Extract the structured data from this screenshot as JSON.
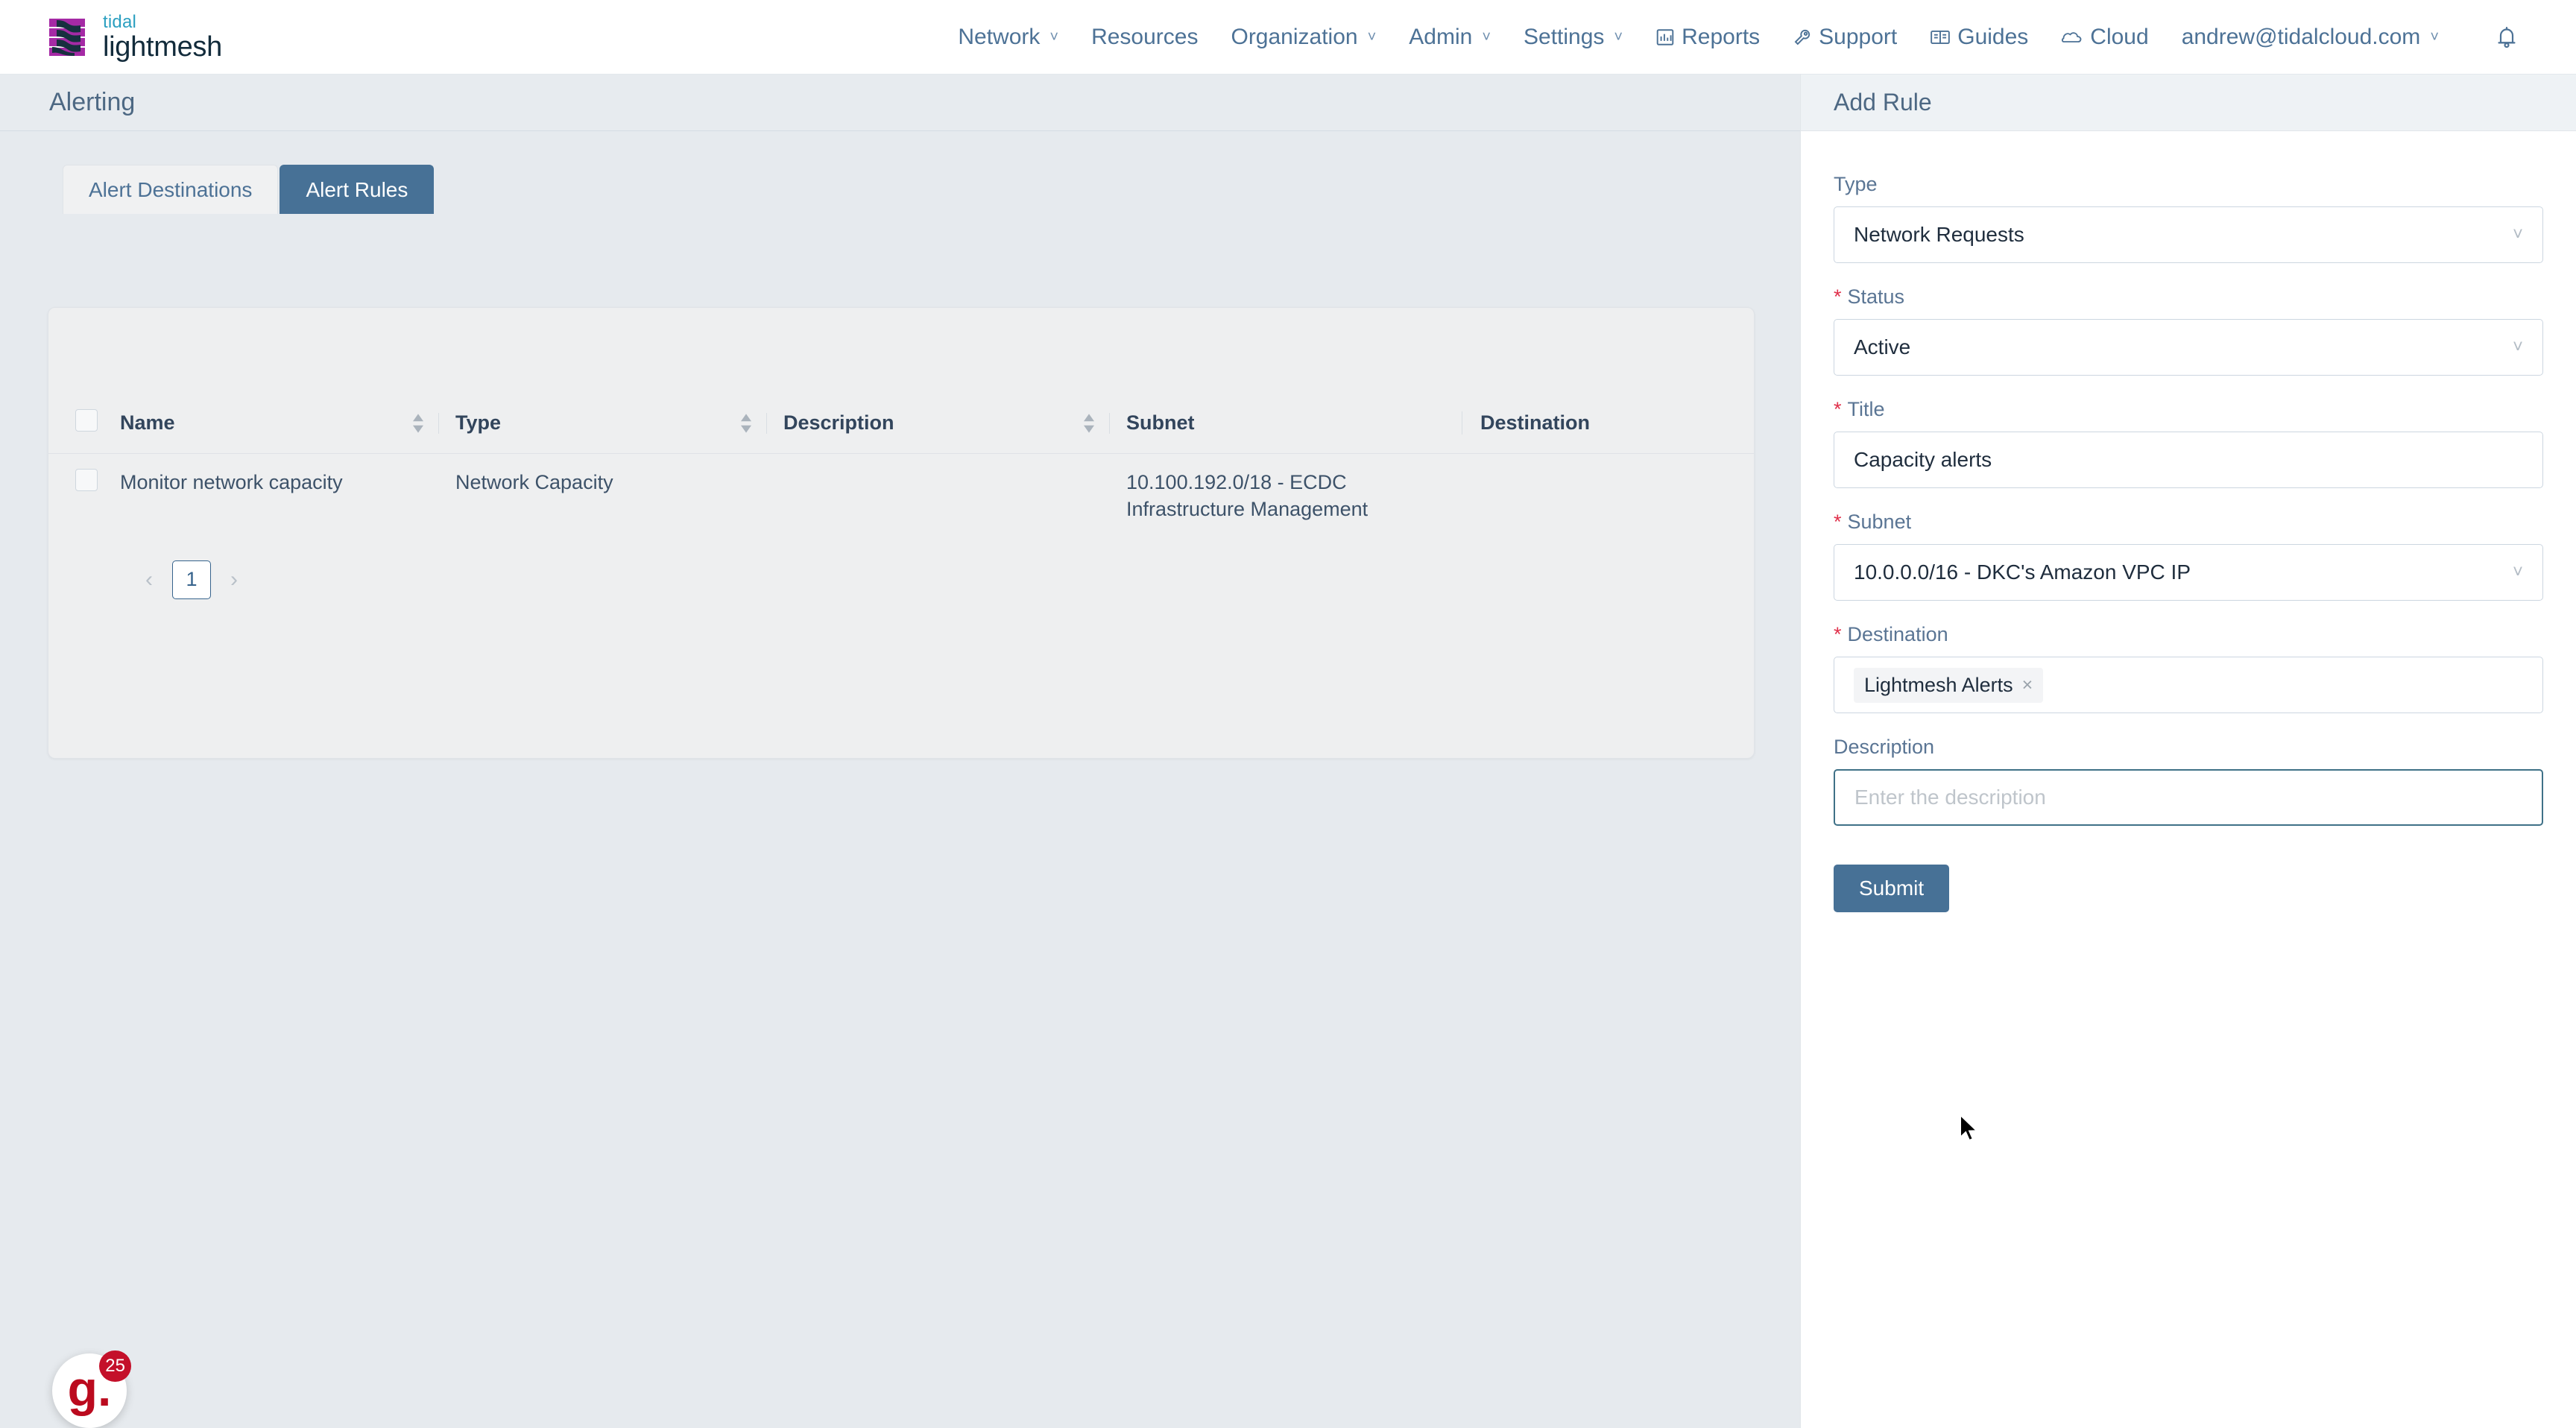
{
  "brand": {
    "name_top": "tidal",
    "name_bottom": "lightmesh",
    "color_mark": "#a52aa5",
    "color_tidal": "#2b9fc0",
    "color_lightmesh": "#122b3b"
  },
  "nav": {
    "items": [
      {
        "label": "Network",
        "icon": "",
        "caret": true,
        "name": "nav-network"
      },
      {
        "label": "Resources",
        "icon": "",
        "caret": false,
        "name": "nav-resources"
      },
      {
        "label": "Organization",
        "icon": "",
        "caret": true,
        "name": "nav-organization"
      },
      {
        "label": "Admin",
        "icon": "",
        "caret": true,
        "name": "nav-admin"
      },
      {
        "label": "Settings",
        "icon": "",
        "caret": true,
        "name": "nav-settings"
      },
      {
        "label": "Reports",
        "icon": "bar-chart-icon",
        "caret": false,
        "name": "nav-reports"
      },
      {
        "label": "Support",
        "icon": "wrench-icon",
        "caret": false,
        "name": "nav-support"
      },
      {
        "label": "Guides",
        "icon": "book-icon",
        "caret": false,
        "name": "nav-guides"
      },
      {
        "label": "Cloud",
        "icon": "cloud-icon",
        "caret": false,
        "name": "nav-cloud"
      },
      {
        "label": "andrew@tidalcloud.com",
        "icon": "",
        "caret": true,
        "name": "nav-account"
      }
    ],
    "notification_icon": "bell-icon"
  },
  "page": {
    "title": "Alerting"
  },
  "tabs": [
    {
      "label": "Alert Destinations",
      "active": false
    },
    {
      "label": "Alert Rules",
      "active": true
    }
  ],
  "table": {
    "columns": [
      {
        "label": "Name",
        "sortable": true
      },
      {
        "label": "Type",
        "sortable": true
      },
      {
        "label": "Description",
        "sortable": true
      },
      {
        "label": "Subnet",
        "sortable": true
      },
      {
        "label": "Destination",
        "sortable": false
      }
    ],
    "rows": [
      {
        "name": "Monitor network capacity",
        "type": "Network Capacity",
        "description": "",
        "subnet": "10.100.192.0/18 - ECDC Infrastructure Management",
        "destination": ""
      }
    ]
  },
  "pagination": {
    "prev": "‹",
    "next": "›",
    "current_page": "1"
  },
  "panel": {
    "title": "Add Rule",
    "fields": {
      "type": {
        "label": "Type",
        "value": "Network Requests",
        "required": false
      },
      "status": {
        "label": "Status",
        "value": "Active",
        "required": true
      },
      "title": {
        "label": "Title",
        "value": "Capacity alerts",
        "required": true
      },
      "subnet": {
        "label": "Subnet",
        "value": "10.0.0.0/16 - DKC's Amazon VPC IP",
        "required": true
      },
      "destination": {
        "label": "Destination",
        "tag": "Lightmesh Alerts",
        "tag_remove": "×",
        "required": true
      },
      "description": {
        "label": "Description",
        "value": "",
        "placeholder": "Enter the description",
        "required": false
      }
    },
    "submit_label": "Submit"
  },
  "chat_widget": {
    "logo_text": "g.",
    "badge_count": "25",
    "color": "#c4102a"
  },
  "theme": {
    "accent": "#477196",
    "page_bg": "#e6eaee",
    "required_red": "#e0314b"
  }
}
